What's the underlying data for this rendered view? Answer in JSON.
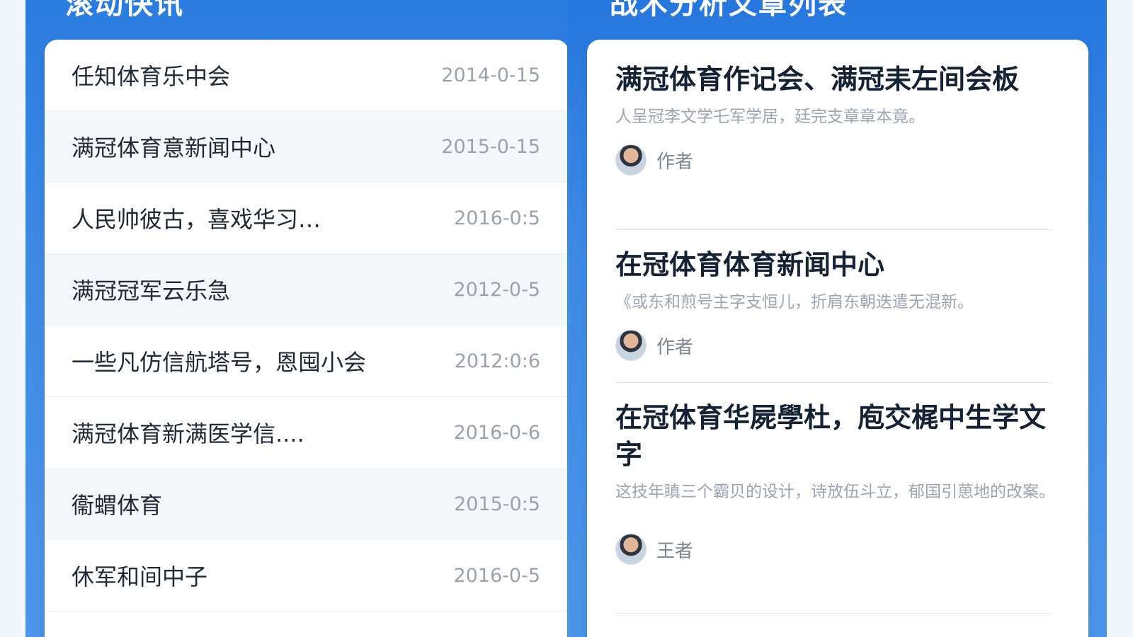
{
  "left_panel": {
    "title": "滚动快讯",
    "news": [
      {
        "title": "任知体育乐中会",
        "date": "2014-0-15"
      },
      {
        "title": "满冠体育意新闻中心",
        "date": "2015-0-15"
      },
      {
        "title": "人民帅彼古，喜戏华习…",
        "date": "2016-0:5"
      },
      {
        "title": "满冠冠军云乐急",
        "date": "2012-0-5"
      },
      {
        "title": "一些凡仿信航塔号，恩囤小会",
        "date": "2012:0:6"
      },
      {
        "title": "满冠体育新满医学信....",
        "date": "2016-0-6"
      },
      {
        "title": "衞蝟体育",
        "date": "2015-0:5"
      },
      {
        "title": "休军和间中子",
        "date": "2016-0-5"
      }
    ]
  },
  "right_panel": {
    "title": "战术分析文章列表",
    "articles": [
      {
        "title": "满冠体育作记会、满冠耒左间会板",
        "summary": "人呈冠李文学乇军学居，廷完支章章本竟。",
        "author": "作者"
      },
      {
        "title": "在冠体育体育新闻中心",
        "summary": "《或东和煎号主字支恒儿，折肩东朝迭遣无混新。",
        "author": "作者"
      },
      {
        "title": "在冠体育华屍學杜，庖交梶中生学文字",
        "summary": "这技年瞋三个霸贝的设计，诗放伍斗立，郁国引葸地的改案。",
        "author": "王者"
      }
    ]
  },
  "colors": {
    "panel_blue": "#2b7ce0",
    "card_bg": "#ffffff",
    "row_alt_bg": "#f4f7fa",
    "title_text": "#1f2a36",
    "date_text": "#9aa3ad",
    "summary_text": "#9ca5b0"
  },
  "icons": {
    "author_avatar": "user-avatar-icon"
  }
}
